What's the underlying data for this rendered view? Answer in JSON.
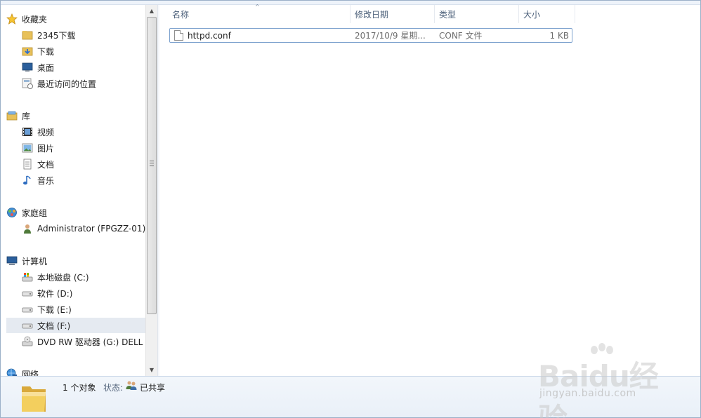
{
  "nav": {
    "items": [
      {
        "label": "收藏夹",
        "icon": "star-icon",
        "header": true
      },
      {
        "label": "2345下载",
        "icon": "folder-icon"
      },
      {
        "label": "下载",
        "icon": "downloads-folder-icon"
      },
      {
        "label": "桌面",
        "icon": "desktop-icon"
      },
      {
        "label": "最近访问的位置",
        "icon": "recent-places-icon"
      },
      {
        "label": "库",
        "icon": "library-icon",
        "header": true
      },
      {
        "label": "视频",
        "icon": "video-icon"
      },
      {
        "label": "图片",
        "icon": "picture-icon"
      },
      {
        "label": "文档",
        "icon": "document-icon"
      },
      {
        "label": "音乐",
        "icon": "music-icon"
      },
      {
        "label": "家庭组",
        "icon": "homegroup-icon",
        "header": true
      },
      {
        "label": "Administrator (FPGZZ-01)",
        "icon": "user-icon"
      },
      {
        "label": "计算机",
        "icon": "computer-icon",
        "header": true
      },
      {
        "label": "本地磁盘 (C:)",
        "icon": "system-drive-icon"
      },
      {
        "label": "软件 (D:)",
        "icon": "drive-icon"
      },
      {
        "label": "下载 (E:)",
        "icon": "drive-icon"
      },
      {
        "label": "文档 (F:)",
        "icon": "drive-icon",
        "selected": true
      },
      {
        "label": "DVD RW 驱动器 (G:) DELL",
        "icon": "dvd-drive-icon"
      },
      {
        "label": "网络",
        "icon": "network-icon",
        "header": true
      }
    ]
  },
  "columns": {
    "name": "名称",
    "date": "修改日期",
    "type": "类型",
    "size": "大小"
  },
  "files": [
    {
      "name": "httpd.conf",
      "date": "2017/10/9 星期...",
      "type": "CONF 文件",
      "size": "1 KB"
    }
  ],
  "details": {
    "count": "1 个对象",
    "state_label": "状态:",
    "state_value": "已共享"
  },
  "watermark": {
    "logo": "Baidu经验",
    "url": "jingyan.baidu.com"
  }
}
